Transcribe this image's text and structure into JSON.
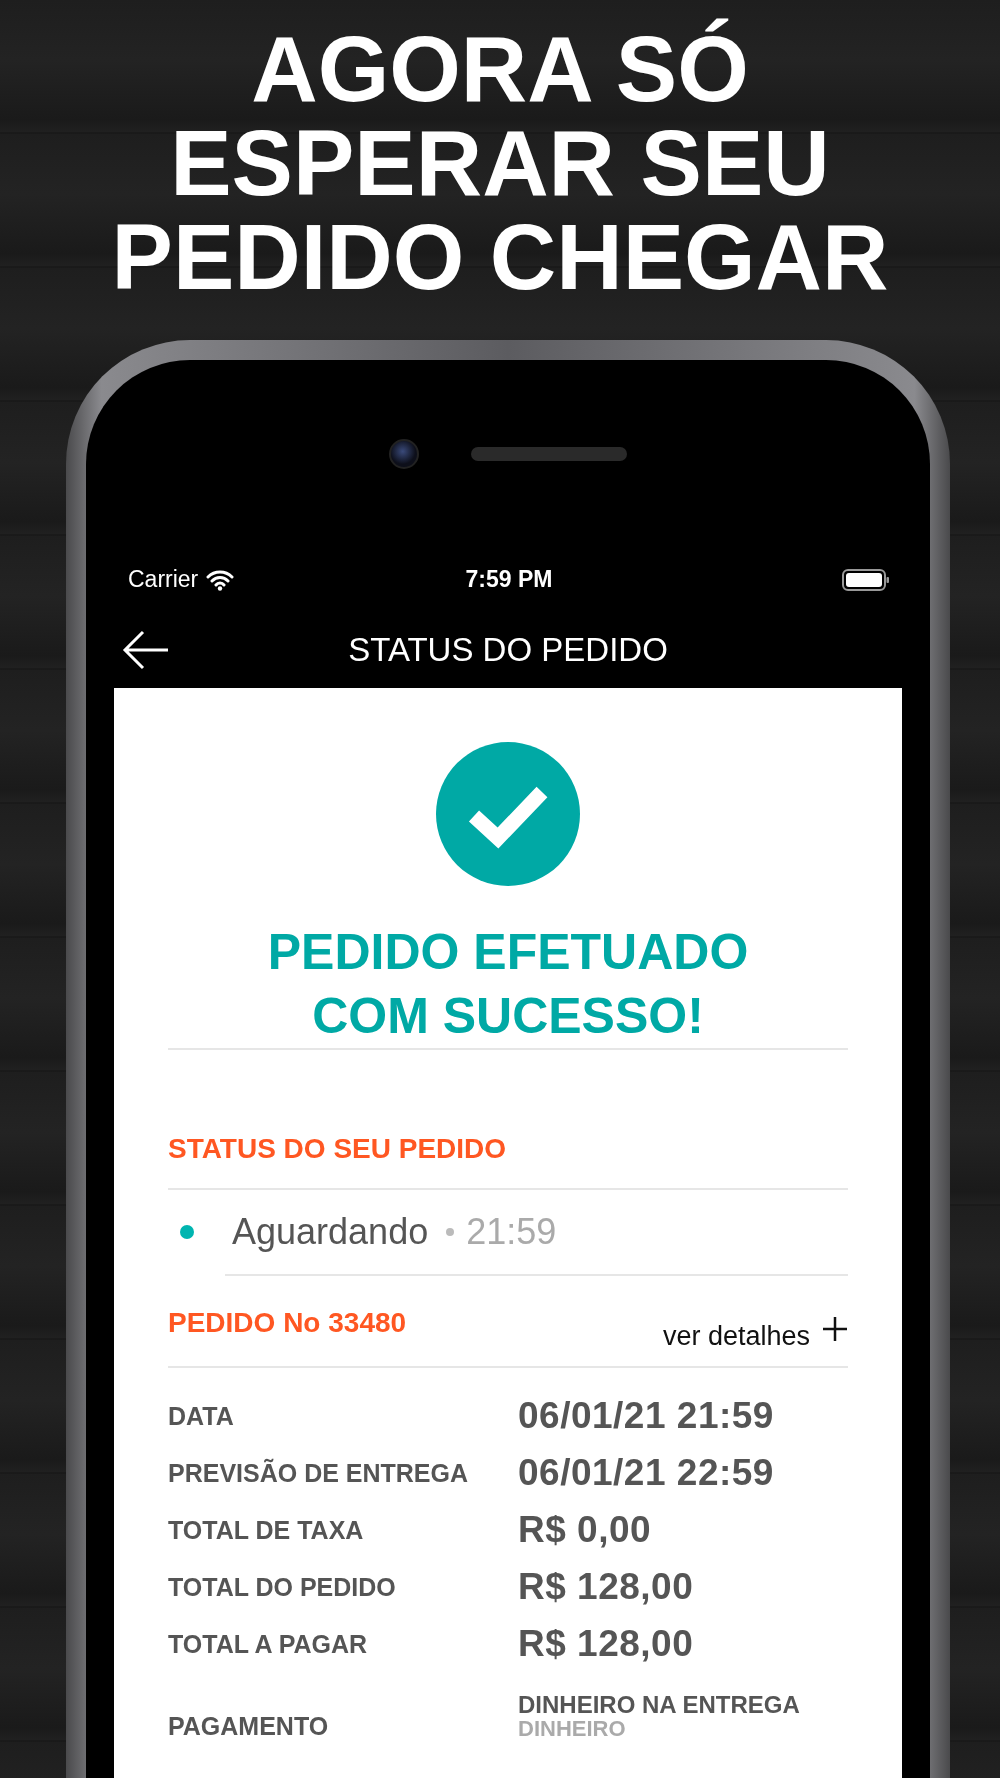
{
  "headline": [
    "AGORA SÓ",
    "ESPERAR SEU",
    "PEDIDO CHEGAR"
  ],
  "status_bar": {
    "carrier": "Carrier",
    "time": "7:59 PM"
  },
  "nav": {
    "title": "STATUS DO PEDIDO"
  },
  "success": {
    "title_lines": [
      "PEDIDO EFETUADO",
      "COM SUCESSO!"
    ]
  },
  "status_section": {
    "heading": "STATUS DO SEU PEDIDO",
    "entries": [
      {
        "status": "Aguardando",
        "time": "21:59"
      }
    ]
  },
  "order": {
    "title": "PEDIDO No 33480",
    "details_link": "ver detalhes",
    "details": [
      {
        "label": "DATA",
        "value": "06/01/21 21:59"
      },
      {
        "label": "PREVISÃO DE ENTREGA",
        "value": "06/01/21 22:59"
      },
      {
        "label": "TOTAL DE TAXA",
        "value": "R$ 0,00"
      },
      {
        "label": "TOTAL DO PEDIDO",
        "value": "R$ 128,00"
      },
      {
        "label": "TOTAL A PAGAR",
        "value": "R$ 128,00"
      },
      {
        "label": "PAGAMENTO",
        "value": "DINHEIRO NA ENTREGA",
        "note": "DINHEIRO"
      }
    ]
  }
}
